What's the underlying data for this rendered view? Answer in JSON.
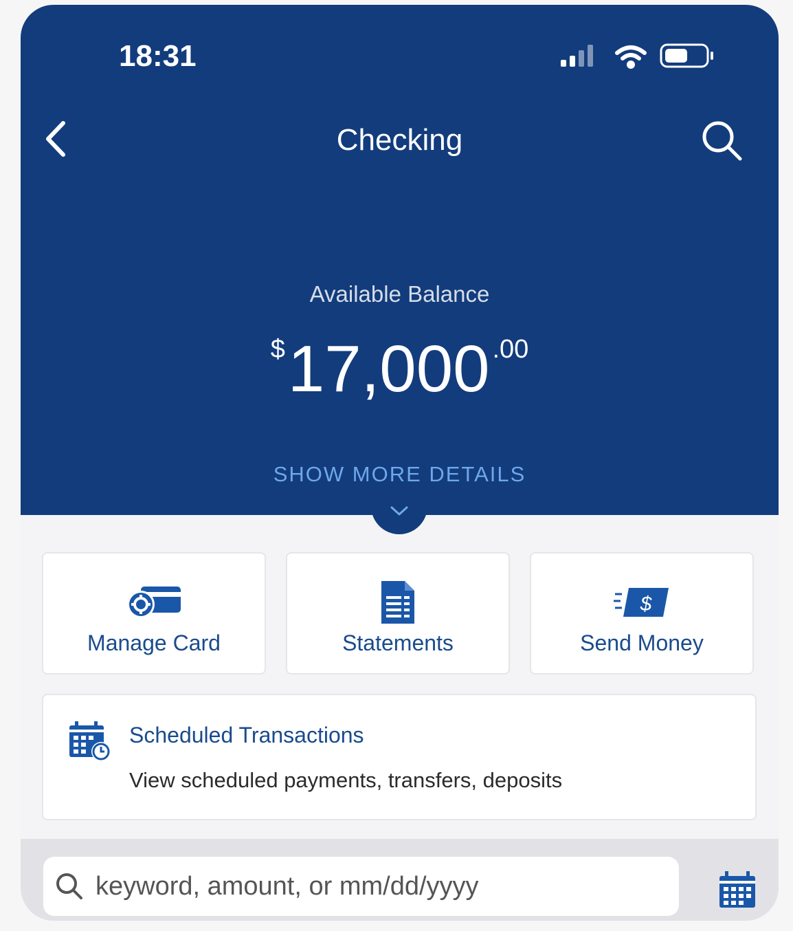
{
  "status_bar": {
    "time": "18:31"
  },
  "header": {
    "title": "Checking"
  },
  "balance": {
    "label": "Available Balance",
    "currency": "$",
    "amount": "17,000",
    "cents": ".00",
    "show_more": "SHOW MORE DETAILS"
  },
  "tiles": [
    {
      "label": "Manage Card",
      "icon": "card-settings-icon"
    },
    {
      "label": "Statements",
      "icon": "statement-document-icon"
    },
    {
      "label": "Send Money",
      "icon": "send-money-icon"
    }
  ],
  "scheduled": {
    "title": "Scheduled Transactions",
    "description": "View scheduled payments, transfers, deposits"
  },
  "search": {
    "placeholder": "keyword, amount, or mm/dd/yyyy"
  },
  "colors": {
    "header": "#123c7c",
    "accent": "#1a4b8c",
    "link": "#6fa8ea"
  }
}
